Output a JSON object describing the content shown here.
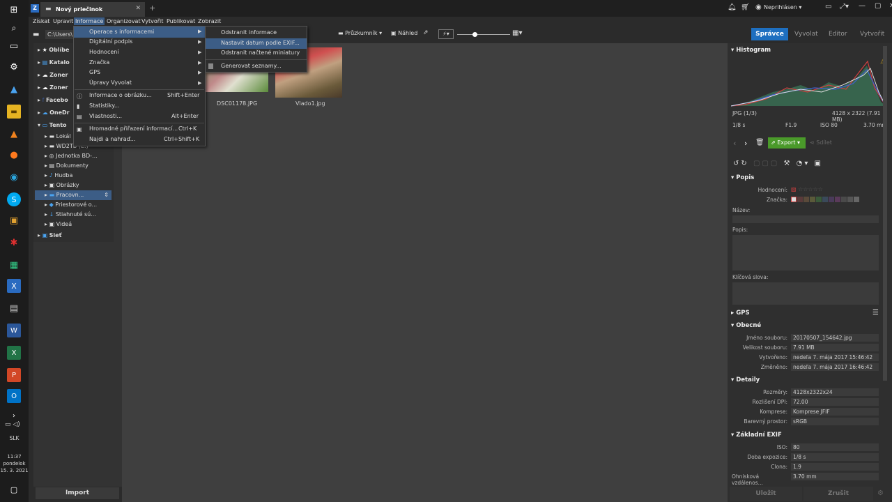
{
  "window": {
    "tab_title": "Nový priečinok",
    "new_tab": "+",
    "account": "Neprihlásen"
  },
  "menubar": [
    "Získat",
    "Upravit",
    "Informace",
    "Organizovat",
    "Vytvořit",
    "Publikovat",
    "Zobrazit"
  ],
  "toolbar": {
    "path": "C:\\Users\\",
    "explorer": "Průzkumník",
    "preview": "Náhled"
  },
  "modes": {
    "manager": "Správce",
    "develop": "Vyvolat",
    "editor": "Editor",
    "create": "Vytvořit"
  },
  "tree": [
    {
      "label": "Oblíbe",
      "bold": true
    },
    {
      "label": "Katalo",
      "bold": true
    },
    {
      "label": "Zoner",
      "bold": true
    },
    {
      "label": "Zoner",
      "bold": true
    },
    {
      "label": "Facebo",
      "bold": true
    },
    {
      "label": "OneDr",
      "bold": true
    },
    {
      "label": "Tento",
      "bold": true
    },
    {
      "label": "Lokál",
      "bold": false
    },
    {
      "label": "WD2TB (E:)",
      "bold": false
    },
    {
      "label": "Jednotka BD-...",
      "bold": false
    },
    {
      "label": "Dokumenty",
      "bold": false
    },
    {
      "label": "Hudba",
      "bold": false
    },
    {
      "label": "Obrázky",
      "bold": false
    },
    {
      "label": "Pracovn...",
      "bold": false
    },
    {
      "label": "Priestorové o...",
      "bold": false
    },
    {
      "label": "Stiahnuté sú...",
      "bold": false
    },
    {
      "label": "Videá",
      "bold": false
    },
    {
      "label": "Sieť",
      "bold": true
    }
  ],
  "import_button": "Import",
  "thumbnails": [
    {
      "name": "DSC01178.JPG"
    },
    {
      "name": "Vlado1.jpg"
    }
  ],
  "menu_info": {
    "items": [
      {
        "label": "Operace s informacemi",
        "shortcut": ""
      },
      {
        "label": "Digitální podpis",
        "shortcut": ""
      },
      {
        "label": "Hodnocení",
        "shortcut": ""
      },
      {
        "label": "Značka",
        "shortcut": ""
      },
      {
        "label": "GPS",
        "shortcut": ""
      },
      {
        "label": "Úpravy Vyvolat",
        "shortcut": ""
      },
      {
        "label": "Informace o obrázku...",
        "shortcut": "Shift+Enter"
      },
      {
        "label": "Statistiky...",
        "shortcut": ""
      },
      {
        "label": "Vlastnosti...",
        "shortcut": "Alt+Enter"
      },
      {
        "label": "Hromadné přiřazení informací...",
        "shortcut": "Ctrl+K"
      },
      {
        "label": "Najdi a nahraď...",
        "shortcut": "Ctrl+Shift+K"
      }
    ]
  },
  "submenu": {
    "items": [
      "Odstranit informace",
      "Nastavit datum podle EXIF...",
      "Odstranit načtené miniatury",
      "Generovat seznamy..."
    ]
  },
  "histogram": {
    "title": "Histogram",
    "format": "JPG",
    "count": "(1/3)",
    "dims": "4128 x 2322 (7.91 MB)",
    "shutter": "1/8 s",
    "aperture": "F1.9",
    "iso": "ISO 80",
    "focal": "3.70 mm"
  },
  "actions": {
    "export": "Export",
    "share": "Sdílet"
  },
  "popis": {
    "title": "Popis",
    "rating": "Hodnocení:",
    "label": "Značka:",
    "name": "Název:",
    "desc": "Popis:",
    "keywords": "Klíčová slova:"
  },
  "gps": {
    "title": "GPS"
  },
  "general": {
    "title": "Obecné",
    "rows": [
      {
        "k": "Jméno souboru:",
        "v": "20170507_154642.jpg"
      },
      {
        "k": "Velikost souboru:",
        "v": "7.91 MB"
      },
      {
        "k": "Vytvořeno:",
        "v": "nedeľa 7. mája 2017 15:46:42"
      },
      {
        "k": "Změněno:",
        "v": "nedeľa 7. mája 2017 16:46:42"
      }
    ]
  },
  "details": {
    "title": "Detaily",
    "rows": [
      {
        "k": "Rozměry:",
        "v": "4128x2322x24"
      },
      {
        "k": "Rozlišení DPI:",
        "v": "72.00"
      },
      {
        "k": "Komprese:",
        "v": "Komprese JFIF"
      },
      {
        "k": "Barevný prostor:",
        "v": "sRGB"
      }
    ]
  },
  "exif": {
    "title": "Základní EXIF",
    "rows": [
      {
        "k": "ISO:",
        "v": "80"
      },
      {
        "k": "Doba expozice:",
        "v": "1/8 s"
      },
      {
        "k": "Clona:",
        "v": "1.9"
      },
      {
        "k": "Ohnisková vzdálenos...",
        "v": "3.70 mm"
      }
    ]
  },
  "bottom": {
    "save": "Uložit",
    "cancel": "Zrušit"
  },
  "clock": {
    "time": "11:37",
    "day": "pondelok",
    "date": "15. 3. 2021",
    "lang": "SLK"
  },
  "colors": {
    "accent": "#1e6fc0",
    "export_green": "#4a9a2a",
    "menu_highlight": "#3c5d86"
  }
}
